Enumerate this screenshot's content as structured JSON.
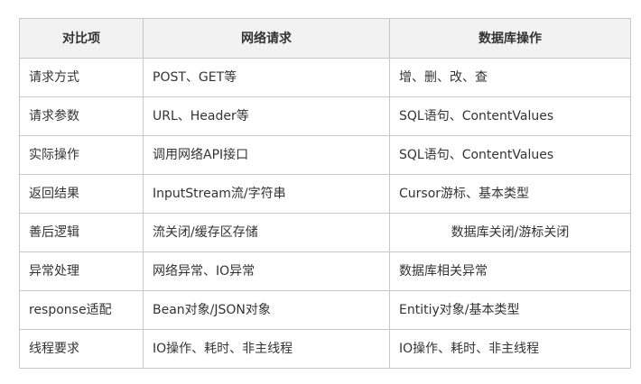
{
  "table": {
    "headers": [
      "对比项",
      "网络请求",
      "数据库操作"
    ],
    "rows": [
      [
        "请求方式",
        "POST、GET等",
        "增、删、改、查"
      ],
      [
        "请求参数",
        "URL、Header等",
        "SQL语句、ContentValues"
      ],
      [
        "实际操作",
        "调用网络API接口",
        "SQL语句、ContentValues"
      ],
      [
        "返回结果",
        "InputStream流/字符串",
        "Cursor游标、基本类型"
      ],
      [
        "善后逻辑",
        "流关闭/缓存区存储",
        "数据库关闭/游标关闭"
      ],
      [
        "异常处理",
        "网络异常、IO异常",
        "数据库相关异常"
      ],
      [
        "response适配",
        "Bean对象/JSON对象",
        "Entitiy对象/基本类型"
      ],
      [
        "线程要求",
        "IO操作、耗时、非主线程",
        "IO操作、耗时、非主线程"
      ]
    ]
  }
}
